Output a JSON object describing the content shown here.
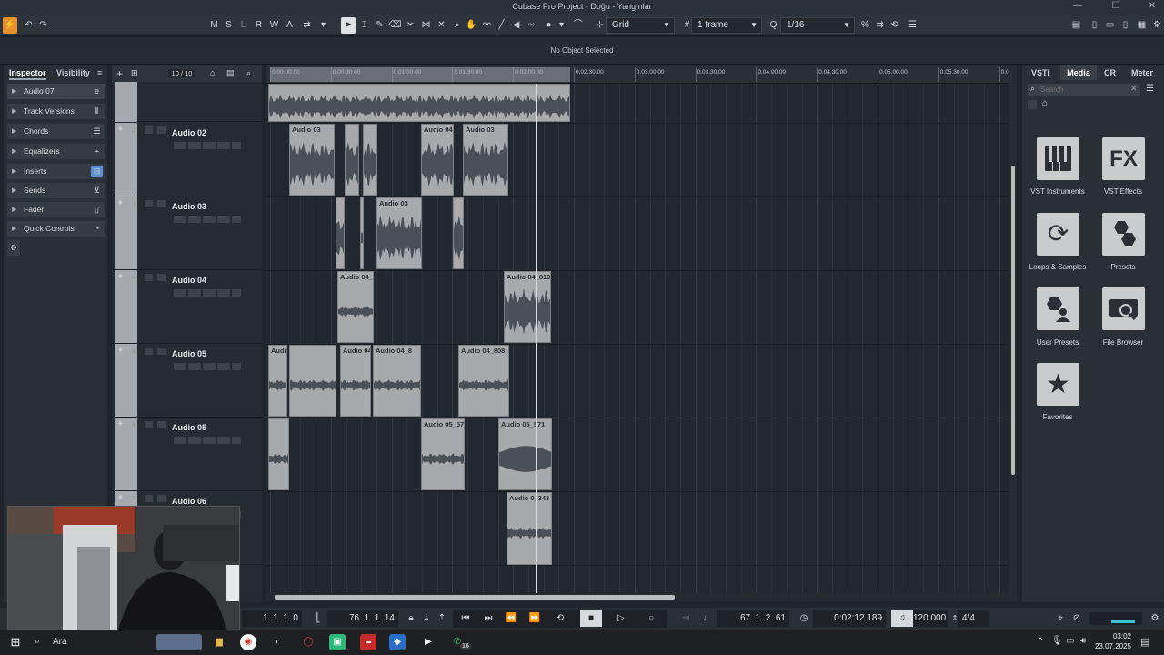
{
  "window": {
    "title": "Cubase Pro Project - Doğu - Yangınlar"
  },
  "toolbar": {
    "mode_buttons": [
      "M",
      "S",
      "L",
      "R",
      "W",
      "A"
    ],
    "snap_type": "Grid",
    "grid_size": "1 frame",
    "quantize": "1/16"
  },
  "info_line": {
    "message": "No Object Selected"
  },
  "inspector": {
    "tabs": [
      "Inspector",
      "Visibility"
    ],
    "track_name": "Audio 07",
    "sections": [
      "Track Versions",
      "Chords",
      "Equalizers",
      "Inserts",
      "Sends",
      "Fader",
      "Quick Controls"
    ]
  },
  "tracklist": {
    "counter": "10 / 10",
    "tracks": [
      {
        "name": "Audio 02",
        "num": "2"
      },
      {
        "name": "Audio 03",
        "num": "3"
      },
      {
        "name": "Audio 04",
        "num": "4"
      },
      {
        "name": "Audio 05",
        "num": "5"
      },
      {
        "name": "Audio 05",
        "num": "6"
      },
      {
        "name": "Audio 06",
        "num": "7"
      }
    ]
  },
  "ruler": {
    "ticks": [
      "0.00.00.00",
      "0.00.30.00",
      "0.01.00.00",
      "0.01.30.00",
      "0.02.00.00",
      "0.02.30.00",
      "0.03.00.00",
      "0.03.30.00",
      "0.04.00.00",
      "0.04.30.00",
      "0.05.00.00",
      "0.05.30.00",
      "0.0"
    ]
  },
  "clips": [
    {
      "label": ""
    },
    {
      "label": "Audio 03"
    },
    {
      "label": ""
    },
    {
      "label": ""
    },
    {
      "label": "Audio 04"
    },
    {
      "label": "Audio 03"
    },
    {
      "label": ""
    },
    {
      "label": ""
    },
    {
      "label": "Audio 03"
    },
    {
      "label": ""
    },
    {
      "label": "Audio 04_"
    },
    {
      "label": "Audio 04_810"
    },
    {
      "label": "Audio 05_569"
    },
    {
      "label": ""
    },
    {
      "label": "Audio 04_808"
    },
    {
      "label": "Audio 04_8"
    },
    {
      "label": "Audio 04_808"
    },
    {
      "label": ""
    },
    {
      "label": "Audio 05_570"
    },
    {
      "label": "Audio 05_571"
    },
    {
      "label": "Audio 0_343"
    }
  ],
  "right_zone": {
    "tabs": [
      "VSTi",
      "Media",
      "CR",
      "Meter"
    ],
    "search_placeholder": "Search",
    "tiles": [
      "VST Instruments",
      "VST Effects",
      "Loops & Samples",
      "Presets",
      "User Presets",
      "File Browser",
      "Favorites"
    ]
  },
  "transport": {
    "left_locator": "1. 1. 1. 0",
    "right_locator": "76. 1. 1. 14",
    "position_bars": "67. 1. 2. 61",
    "position_time": "0:02:12.189",
    "tempo": "120.000",
    "signature": "4/4"
  },
  "taskbar": {
    "search_label": "Ara",
    "time": "03:02",
    "date": "23.07.2025",
    "whatsapp_badge": "16"
  },
  "colors": {
    "accent_orange": "#e8912a",
    "clip_gray": "#a7a9ac",
    "arrange_bg": "#232830"
  }
}
